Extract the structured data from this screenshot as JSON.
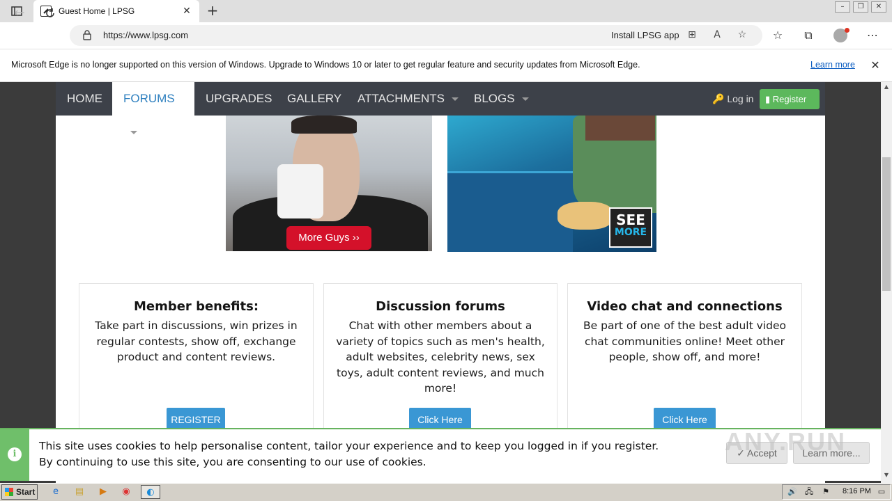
{
  "browser": {
    "tab_title": "Guest Home | LPSG",
    "tab_close": "✕",
    "new_tab": "+",
    "url": "https://www.lpsg.com",
    "install_app": "Install LPSG app"
  },
  "infobar": {
    "message": "Microsoft Edge is no longer supported on this version of Windows. Upgrade to Windows 10 or later to get regular feature and security updates from Microsoft Edge.",
    "link": "Learn more",
    "close": "✕"
  },
  "site_nav": {
    "items": [
      {
        "label": "HOME"
      },
      {
        "label": "FORUMS"
      },
      {
        "label": "UPGRADES"
      },
      {
        "label": "GALLERY"
      },
      {
        "label": "ATTACHMENTS"
      },
      {
        "label": "BLOGS"
      }
    ],
    "login": "Log in",
    "register": "Register"
  },
  "promos": {
    "more_guys": "More Guys ››",
    "see_more_top": "SEE",
    "see_more_bottom": "MORE"
  },
  "cards": [
    {
      "title": "Member benefits:",
      "body": "Take part in discussions, win prizes in regular contests, show off, exchange product and content reviews.",
      "button": "REGISTER"
    },
    {
      "title": "Discussion forums",
      "body": "Chat with other members about a variety of topics such as men's health, adult websites, celebrity news, sex toys, adult content reviews, and much more!",
      "button": "Click Here"
    },
    {
      "title": "Video chat and connections",
      "body": "Be part of one of the best adult video chat communities online! Meet other people, show off, and more!",
      "button": "Click Here"
    }
  ],
  "cookie": {
    "line1": "This site uses cookies to help personalise content, tailor your experience and to keep you logged in if you register.",
    "line2": "By continuing to use this site, you are consenting to our use of cookies.",
    "accept": "✓ Accept",
    "learn_more": "Learn more..."
  },
  "watermark": "ANY.RUN",
  "taskbar": {
    "start": "Start",
    "clock": "8:16 PM"
  },
  "colors": {
    "nav_bg": "#3d4149",
    "nav_active_text": "#2d7fbf",
    "register_green": "#5cb85c",
    "more_guys_red": "#d4112a",
    "card_button_blue": "#3a97d4",
    "cookie_green": "#6fbf6a"
  }
}
